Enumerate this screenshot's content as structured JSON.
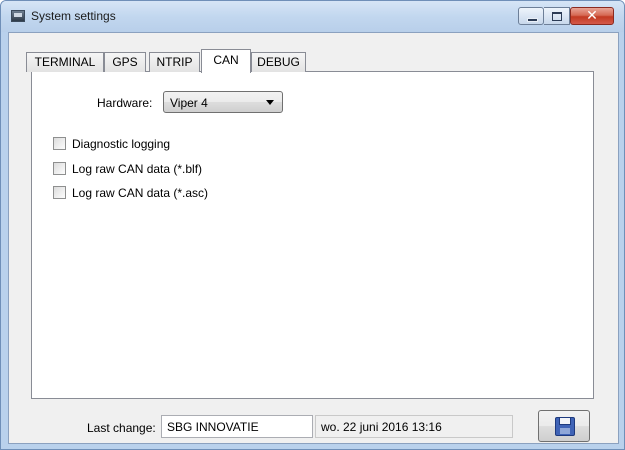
{
  "window": {
    "title": "System settings",
    "close_glyph": "✕"
  },
  "tabs": [
    {
      "label": "TERMINAL",
      "active": false
    },
    {
      "label": "GPS",
      "active": false
    },
    {
      "label": "NTRIP",
      "active": false
    },
    {
      "label": "CAN",
      "active": true
    },
    {
      "label": "DEBUG",
      "active": false
    }
  ],
  "can": {
    "hardware_label": "Hardware:",
    "hardware_value": "Viper 4",
    "checkboxes": [
      {
        "label": "Diagnostic logging",
        "checked": false
      },
      {
        "label": "Log raw CAN data (*.blf)",
        "checked": false
      },
      {
        "label": "Log raw CAN data (*.asc)",
        "checked": false
      }
    ]
  },
  "footer": {
    "last_change_label": "Last change:",
    "user": "SBG INNOVATIE",
    "date": "wo. 22 juni 2016 13:16"
  },
  "icons": {
    "app": "window-icon",
    "save": "floppy-disk-icon"
  }
}
